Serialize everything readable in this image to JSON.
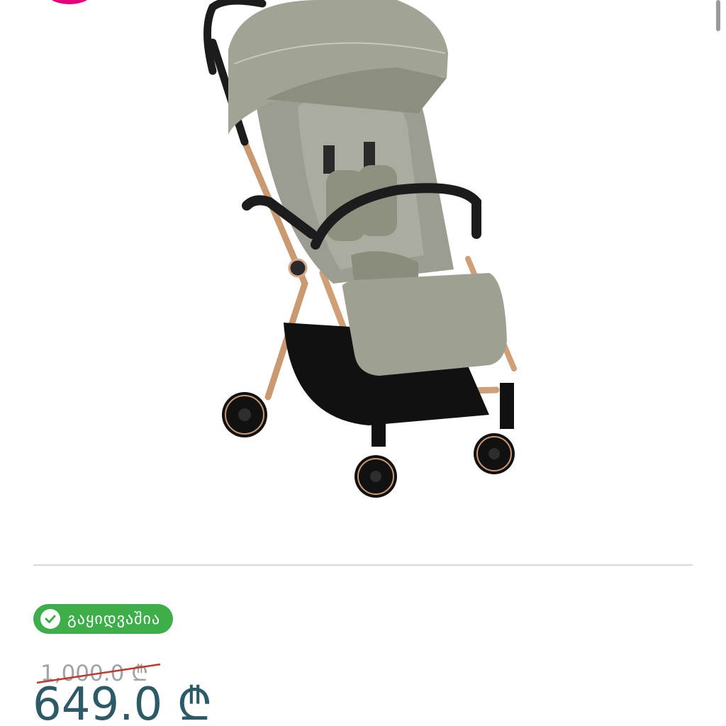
{
  "product": {
    "image_alt": "stroller-product-image",
    "status": {
      "label": "გაყიდვაშია",
      "icon": "check-circle-icon",
      "color": "#3dae49"
    },
    "old_price": "1,000.0 ₾",
    "new_price": "649.0 ₾"
  },
  "colors": {
    "brand": "#e6007e",
    "price": "#2c5a66",
    "old_price": "#9ea3a8",
    "strike": "#c0392b"
  }
}
